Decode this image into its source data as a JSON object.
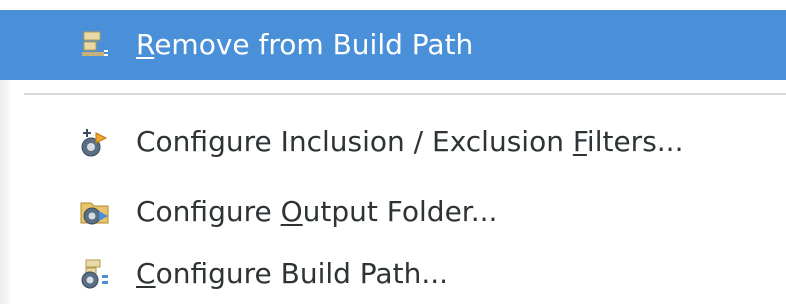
{
  "menu": {
    "items": [
      {
        "id": "remove",
        "label": "Remove from Build Path",
        "mnemonic": "R",
        "icon": "remove-build-path-icon",
        "selected": true
      },
      {
        "id": "filters",
        "label": "Configure Inclusion / Exclusion Filters...",
        "mnemonic": "F",
        "icon": "inclusion-exclusion-filters-icon",
        "selected": false
      },
      {
        "id": "output",
        "label": "Configure Output Folder...",
        "mnemonic": "O",
        "icon": "output-folder-icon",
        "selected": false
      },
      {
        "id": "buildpath",
        "label": "Configure Build Path...",
        "mnemonic": "C",
        "icon": "build-path-icon",
        "selected": false
      }
    ]
  },
  "colors": {
    "selection_bg": "#4a90d9",
    "selection_text": "#ffffff",
    "text": "#2e3436",
    "separator": "#d8d8d8"
  }
}
